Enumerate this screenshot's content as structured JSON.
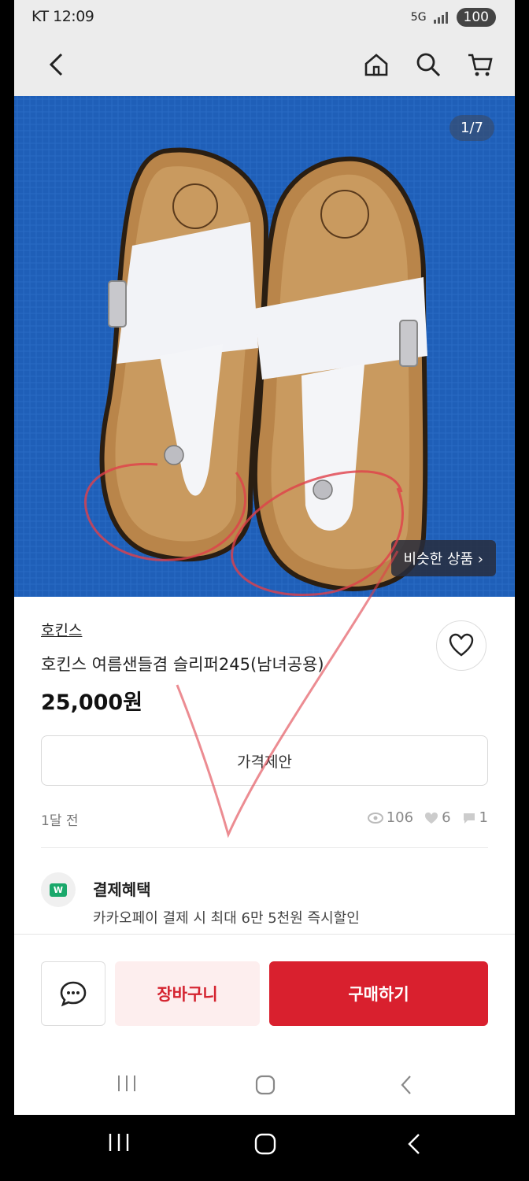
{
  "status": {
    "time": "KT 12:09",
    "battery": "100",
    "network": "5G"
  },
  "hero": {
    "counter": "1/7",
    "similar_label": "비슷한 상품 ›"
  },
  "product": {
    "brand": "호킨스",
    "title": "호킨스 여름샌들겸 슬리퍼245(남녀공용)",
    "price": "25,000원",
    "offer_label": "가격제안",
    "posted": "1달 전",
    "views": "106",
    "likes": "6",
    "chats": "1"
  },
  "benefit": {
    "badge": "W",
    "title": "결제혜택",
    "text": "카카오페이 결제 시 최대 6만 5천원 즉시할인"
  },
  "actions": {
    "cart_label": "장바구니",
    "buy_label": "구매하기"
  },
  "colors": {
    "accent": "#d9202e",
    "hero_bg": "#1f5fb8",
    "annotation": "#e0404a"
  }
}
